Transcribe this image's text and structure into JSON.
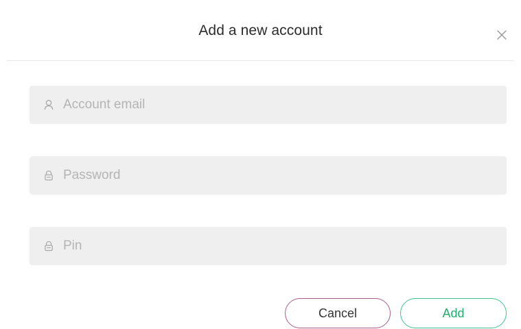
{
  "dialog": {
    "title": "Add a new account",
    "close_icon": "close-icon"
  },
  "fields": {
    "email": {
      "placeholder": "Account email",
      "value": "",
      "icon": "user-icon"
    },
    "password": {
      "placeholder": "Password",
      "value": "",
      "icon": "lock-icon"
    },
    "pin": {
      "placeholder": "Pin",
      "value": "",
      "icon": "lock-icon"
    }
  },
  "actions": {
    "cancel_label": "Cancel",
    "add_label": "Add"
  },
  "colors": {
    "cancel_border": "#a85a8a",
    "add_border": "#3ec48a",
    "add_text": "#1fae6b",
    "field_bg": "#efefef",
    "placeholder": "#b4b4b4"
  }
}
